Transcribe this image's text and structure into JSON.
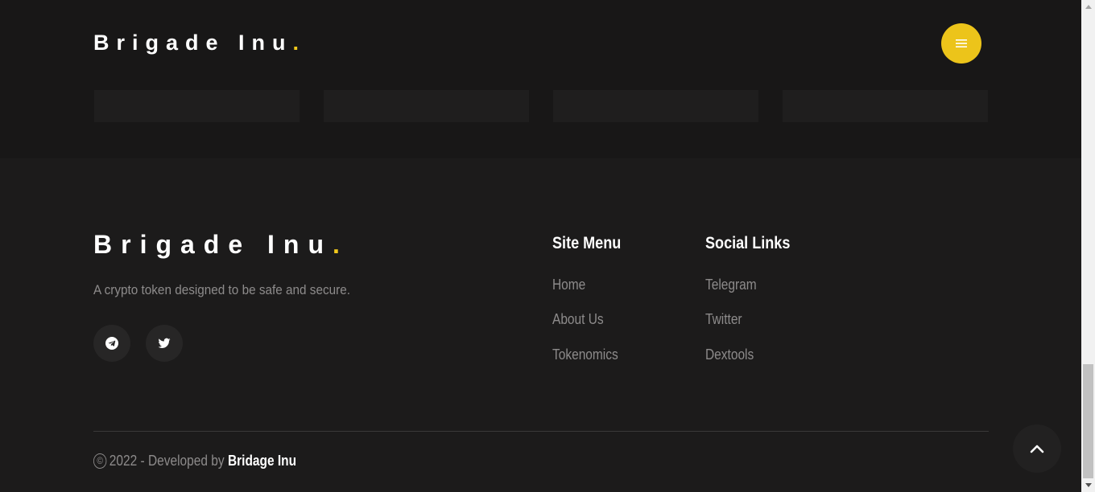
{
  "header": {
    "brand_text": "Brigade Inu",
    "brand_dot": ".",
    "menu_icon": "hamburger-icon"
  },
  "footer": {
    "brand_text": "Brigade Inu",
    "brand_dot": ".",
    "tagline": "A crypto token designed to be safe and secure.",
    "social_icons": [
      "telegram-icon",
      "twitter-icon"
    ],
    "site_menu": {
      "title": "Site Menu",
      "items": [
        "Home",
        "About Us",
        "Tokenomics"
      ]
    },
    "social_links": {
      "title": "Social Links",
      "items": [
        "Telegram",
        "Twitter",
        "Dextools"
      ]
    },
    "copyright": {
      "symbol": "©",
      "text": "2022 - Developed by",
      "developer": "Bridage Inu"
    }
  },
  "colors": {
    "accent": "#ecc41a",
    "background": "#1c1b1b",
    "muted_text": "#8d8b8b"
  }
}
